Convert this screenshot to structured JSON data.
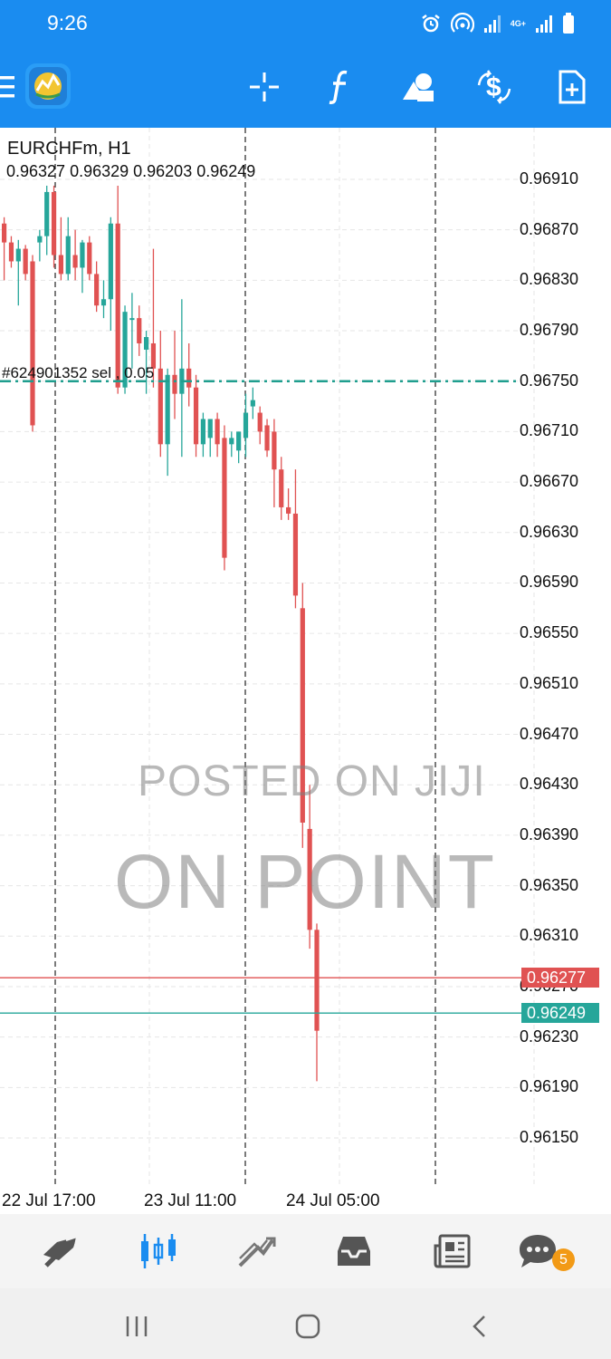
{
  "status_bar": {
    "time": "9:26",
    "network_label": "4G+"
  },
  "toolbar": {
    "icons": [
      "menu-icon",
      "app-logo",
      "crosshair-icon",
      "indicators-icon",
      "objects-icon",
      "trade-icon",
      "new-order-icon"
    ]
  },
  "chart": {
    "symbol_timeframe": "EURCHFm, H1",
    "ohlc": "0.96327 0.96329 0.96203 0.96249",
    "order_label": "#624901352 sel , 0.05",
    "order_price": 0.9675,
    "ask_price": "0.96277",
    "bid_price": "0.96249",
    "ask_color": "#e05252",
    "bid_color": "#26a69a",
    "watermark_line1": "POSTED ON JIJI",
    "watermark_line2": "ON POINT"
  },
  "chart_data": {
    "type": "candlestick",
    "y_ticks": [
      "0.96910",
      "0.96870",
      "0.96830",
      "0.96790",
      "0.96750",
      "0.96710",
      "0.96670",
      "0.96630",
      "0.96590",
      "0.96550",
      "0.96510",
      "0.96470",
      "0.96430",
      "0.96390",
      "0.96350",
      "0.96310",
      "0.96270",
      "0.96230",
      "0.96190",
      "0.96150"
    ],
    "x_ticks": [
      "22 Jul 17:00",
      "23 Jul 11:00",
      "24 Jul 05:00"
    ],
    "ylim": [
      0.9612,
      0.9696
    ],
    "up_color": "#26a69a",
    "down_color": "#e05252",
    "candles": [
      [
        0.96875,
        0.9688,
        0.9683,
        0.9686
      ],
      [
        0.9686,
        0.96865,
        0.9684,
        0.96845
      ],
      [
        0.96845,
        0.96862,
        0.9681,
        0.96855
      ],
      [
        0.96855,
        0.96858,
        0.9683,
        0.96835
      ],
      [
        0.96845,
        0.9685,
        0.9671,
        0.96715
      ],
      [
        0.9686,
        0.9687,
        0.96845,
        0.96865
      ],
      [
        0.96865,
        0.96905,
        0.9685,
        0.969
      ],
      [
        0.969,
        0.96905,
        0.9684,
        0.9685
      ],
      [
        0.9685,
        0.9688,
        0.9683,
        0.96835
      ],
      [
        0.96835,
        0.9688,
        0.9683,
        0.96865
      ],
      [
        0.9685,
        0.9687,
        0.9683,
        0.9684
      ],
      [
        0.9684,
        0.96862,
        0.9682,
        0.9686
      ],
      [
        0.9686,
        0.96865,
        0.9683,
        0.96835
      ],
      [
        0.96835,
        0.96845,
        0.96805,
        0.9681
      ],
      [
        0.9681,
        0.9683,
        0.968,
        0.96815
      ],
      [
        0.96815,
        0.9688,
        0.9679,
        0.96875
      ],
      [
        0.96875,
        0.96905,
        0.9674,
        0.96745
      ],
      [
        0.96745,
        0.9681,
        0.9674,
        0.96805
      ],
      [
        0.968,
        0.9682,
        0.9676,
        0.968
      ],
      [
        0.968,
        0.9681,
        0.9677,
        0.9678
      ],
      [
        0.96775,
        0.9679,
        0.9674,
        0.96785
      ],
      [
        0.9678,
        0.96855,
        0.96745,
        0.9676
      ],
      [
        0.9676,
        0.9679,
        0.9669,
        0.967
      ],
      [
        0.967,
        0.9676,
        0.96675,
        0.96755
      ],
      [
        0.96755,
        0.9679,
        0.9672,
        0.9674
      ],
      [
        0.9674,
        0.96815,
        0.9669,
        0.9676
      ],
      [
        0.9676,
        0.9678,
        0.9673,
        0.96745
      ],
      [
        0.96745,
        0.96755,
        0.9669,
        0.967
      ],
      [
        0.967,
        0.96725,
        0.9669,
        0.9672
      ],
      [
        0.96705,
        0.9672,
        0.9669,
        0.9672
      ],
      [
        0.9672,
        0.96725,
        0.9669,
        0.967
      ],
      [
        0.96705,
        0.96715,
        0.966,
        0.9661
      ],
      [
        0.967,
        0.9671,
        0.9669,
        0.96705
      ],
      [
        0.96695,
        0.9671,
        0.96685,
        0.9671
      ],
      [
        0.96705,
        0.9674,
        0.9669,
        0.96725
      ],
      [
        0.9673,
        0.96745,
        0.9672,
        0.96735
      ],
      [
        0.96725,
        0.9673,
        0.967,
        0.9671
      ],
      [
        0.96715,
        0.9672,
        0.9669,
        0.96695
      ],
      [
        0.9671,
        0.9672,
        0.9665,
        0.9668
      ],
      [
        0.9668,
        0.9669,
        0.9664,
        0.9665
      ],
      [
        0.9665,
        0.96665,
        0.9664,
        0.96645
      ],
      [
        0.96645,
        0.9668,
        0.9657,
        0.9658
      ],
      [
        0.9657,
        0.9659,
        0.9638,
        0.964
      ],
      [
        0.96395,
        0.9643,
        0.963,
        0.96315
      ],
      [
        0.96315,
        0.9632,
        0.96195,
        0.96235
      ]
    ],
    "order_line": 0.9675,
    "ask_line": 0.96277,
    "bid_line": 0.96249
  },
  "bottom_nav": {
    "items": [
      "quotes-icon",
      "chart-icon",
      "trade-icon",
      "history-icon",
      "news-icon",
      "messages-icon"
    ],
    "active": "chart-icon",
    "messages_badge": "5"
  }
}
